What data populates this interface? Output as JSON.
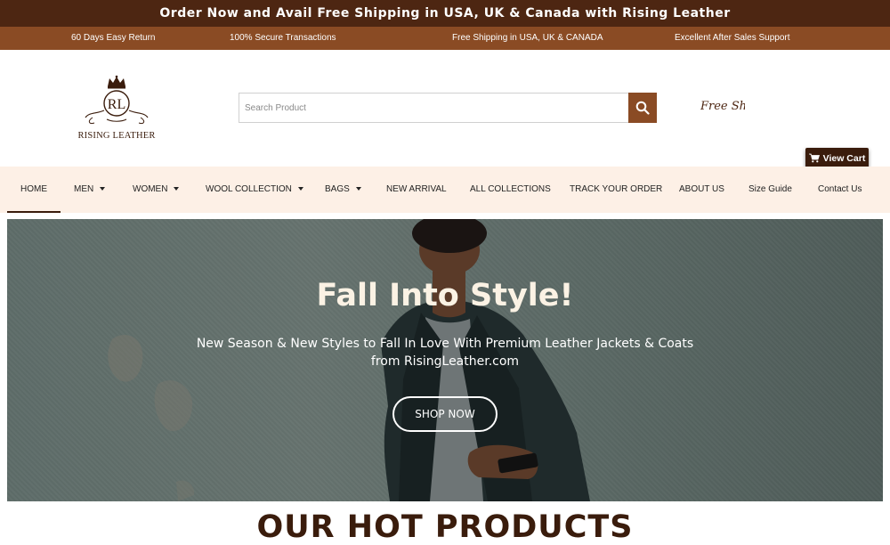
{
  "topbar": {
    "announcement": "Order Now and Avail Free Shipping in USA, UK & Canada with Rising Leather"
  },
  "features": [
    "60 Days Easy Return",
    "100% Secure Transactions",
    "Free Shipping in USA, UK & CANADA",
    "Excellent After Sales Support"
  ],
  "header": {
    "logo_monogram": "RL",
    "logo_text": "RISING LEATHER",
    "search_placeholder": "Search Product",
    "search_icon": "search-icon",
    "free_shipping_text": "Free Shipping",
    "cart_icon": "cart-icon",
    "cart_label": "View Cart"
  },
  "nav": {
    "items": [
      {
        "label": "HOME",
        "active": true
      },
      {
        "label": "MEN",
        "dropdown": true
      },
      {
        "label": "WOMEN",
        "dropdown": true
      },
      {
        "label": "WOOL COLLECTION",
        "dropdown": true
      },
      {
        "label": "BAGS",
        "dropdown": true
      },
      {
        "label": "NEW ARRIVAL"
      },
      {
        "label": "ALL COLLECTIONS"
      },
      {
        "label": "TRACK YOUR ORDER"
      },
      {
        "label": "ABOUT US"
      },
      {
        "label": "Size Guide"
      },
      {
        "label": "Contact Us"
      }
    ]
  },
  "hero": {
    "title": "Fall Into Style!",
    "subtitle": "New Season & New Styles to Fall In Love With Premium Leather Jackets & Coats from RisingLeather.com",
    "button_label": "SHOP NOW"
  },
  "section": {
    "title": "OUR HOT PRODUCTS"
  },
  "colors": {
    "dark_brown": "#4d2612",
    "brown": "#8a4b24",
    "nav_bg": "#fdf0e6",
    "hero_title": "#fbf2e4"
  }
}
